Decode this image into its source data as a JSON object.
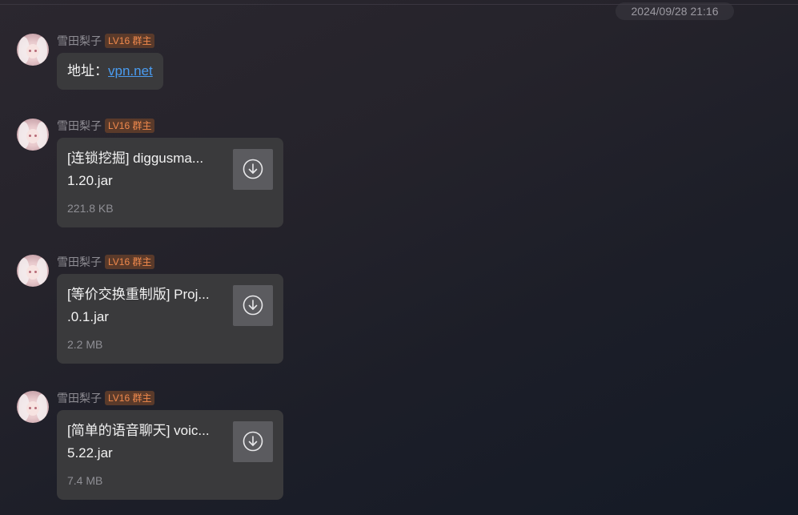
{
  "header": {
    "timestamp": "2024/09/28 21:16"
  },
  "messages": [
    {
      "sender": "雪田梨子",
      "badge": "LV16 群主",
      "type": "text",
      "text_prefix": "地址：",
      "link": "vpn.net"
    },
    {
      "sender": "雪田梨子",
      "badge": "LV16 群主",
      "type": "file",
      "file_name_line1": "[连锁挖掘] diggusma...",
      "file_name_line2": "1.20.jar",
      "file_size": "221.8 KB",
      "icon": "download-icon"
    },
    {
      "sender": "雪田梨子",
      "badge": "LV16 群主",
      "type": "file",
      "file_name_line1": "[等价交换重制版] Proj...",
      "file_name_line2": ".0.1.jar",
      "file_size": "2.2 MB",
      "icon": "download-icon"
    },
    {
      "sender": "雪田梨子",
      "badge": "LV16 群主",
      "type": "file",
      "file_name_line1": "[简单的语音聊天] voic...",
      "file_name_line2": "5.22.jar",
      "file_size": "7.4 MB",
      "icon": "download-icon"
    }
  ],
  "colors": {
    "badge_text": "#f0894d",
    "badge_bg": "#5a3a2a",
    "link": "#4a9cf0",
    "bubble": "#3a3a3c"
  }
}
